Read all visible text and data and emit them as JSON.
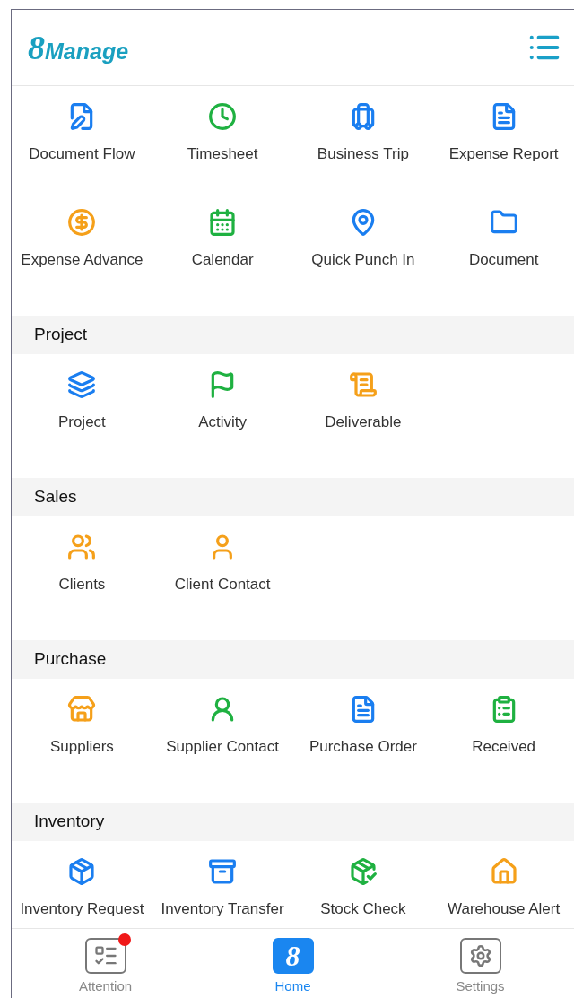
{
  "header": {
    "logo": {
      "numeral": "8",
      "word": "Manage"
    }
  },
  "sections": [
    {
      "items": [
        {
          "label": "Document Flow",
          "color": "#1a7ef0"
        },
        {
          "label": "Timesheet",
          "color": "#1fb141"
        },
        {
          "label": "Business Trip",
          "color": "#1a7ef0"
        },
        {
          "label": "Expense Report",
          "color": "#1a7ef0"
        },
        {
          "label": "Expense Advance",
          "color": "#f5a01a"
        },
        {
          "label": "Calendar",
          "color": "#1fb141"
        },
        {
          "label": "Quick Punch In",
          "color": "#1a7ef0"
        },
        {
          "label": "Document",
          "color": "#1a7ef0"
        }
      ]
    },
    {
      "title": "Project",
      "items": [
        {
          "label": "Project",
          "color": "#1a7ef0"
        },
        {
          "label": "Activity",
          "color": "#1fb141"
        },
        {
          "label": "Deliverable",
          "color": "#f5a01a"
        }
      ]
    },
    {
      "title": "Sales",
      "items": [
        {
          "label": "Clients",
          "color": "#f5a01a"
        },
        {
          "label": "Client Contact",
          "color": "#f5a01a"
        }
      ]
    },
    {
      "title": "Purchase",
      "items": [
        {
          "label": "Suppliers",
          "color": "#f5a01a"
        },
        {
          "label": "Supplier Contact",
          "color": "#1fb141"
        },
        {
          "label": "Purchase Order",
          "color": "#1a7ef0"
        },
        {
          "label": "Received",
          "color": "#1fb141"
        }
      ]
    },
    {
      "title": "Inventory",
      "items": [
        {
          "label": "Inventory Request",
          "color": "#1a7ef0"
        },
        {
          "label": "Inventory Transfer",
          "color": "#1a7ef0"
        },
        {
          "label": "Stock Check",
          "color": "#1fb141"
        },
        {
          "label": "Warehouse Alert",
          "color": "#f5a01a"
        }
      ]
    }
  ],
  "nav": [
    {
      "kind": "list",
      "label": "Attention",
      "selected": false,
      "badge": true
    },
    {
      "kind": "logo",
      "label": "Home",
      "glyph": "8",
      "selected": true,
      "badge": false
    },
    {
      "kind": "gear",
      "label": "Settings",
      "selected": false,
      "badge": false
    }
  ]
}
